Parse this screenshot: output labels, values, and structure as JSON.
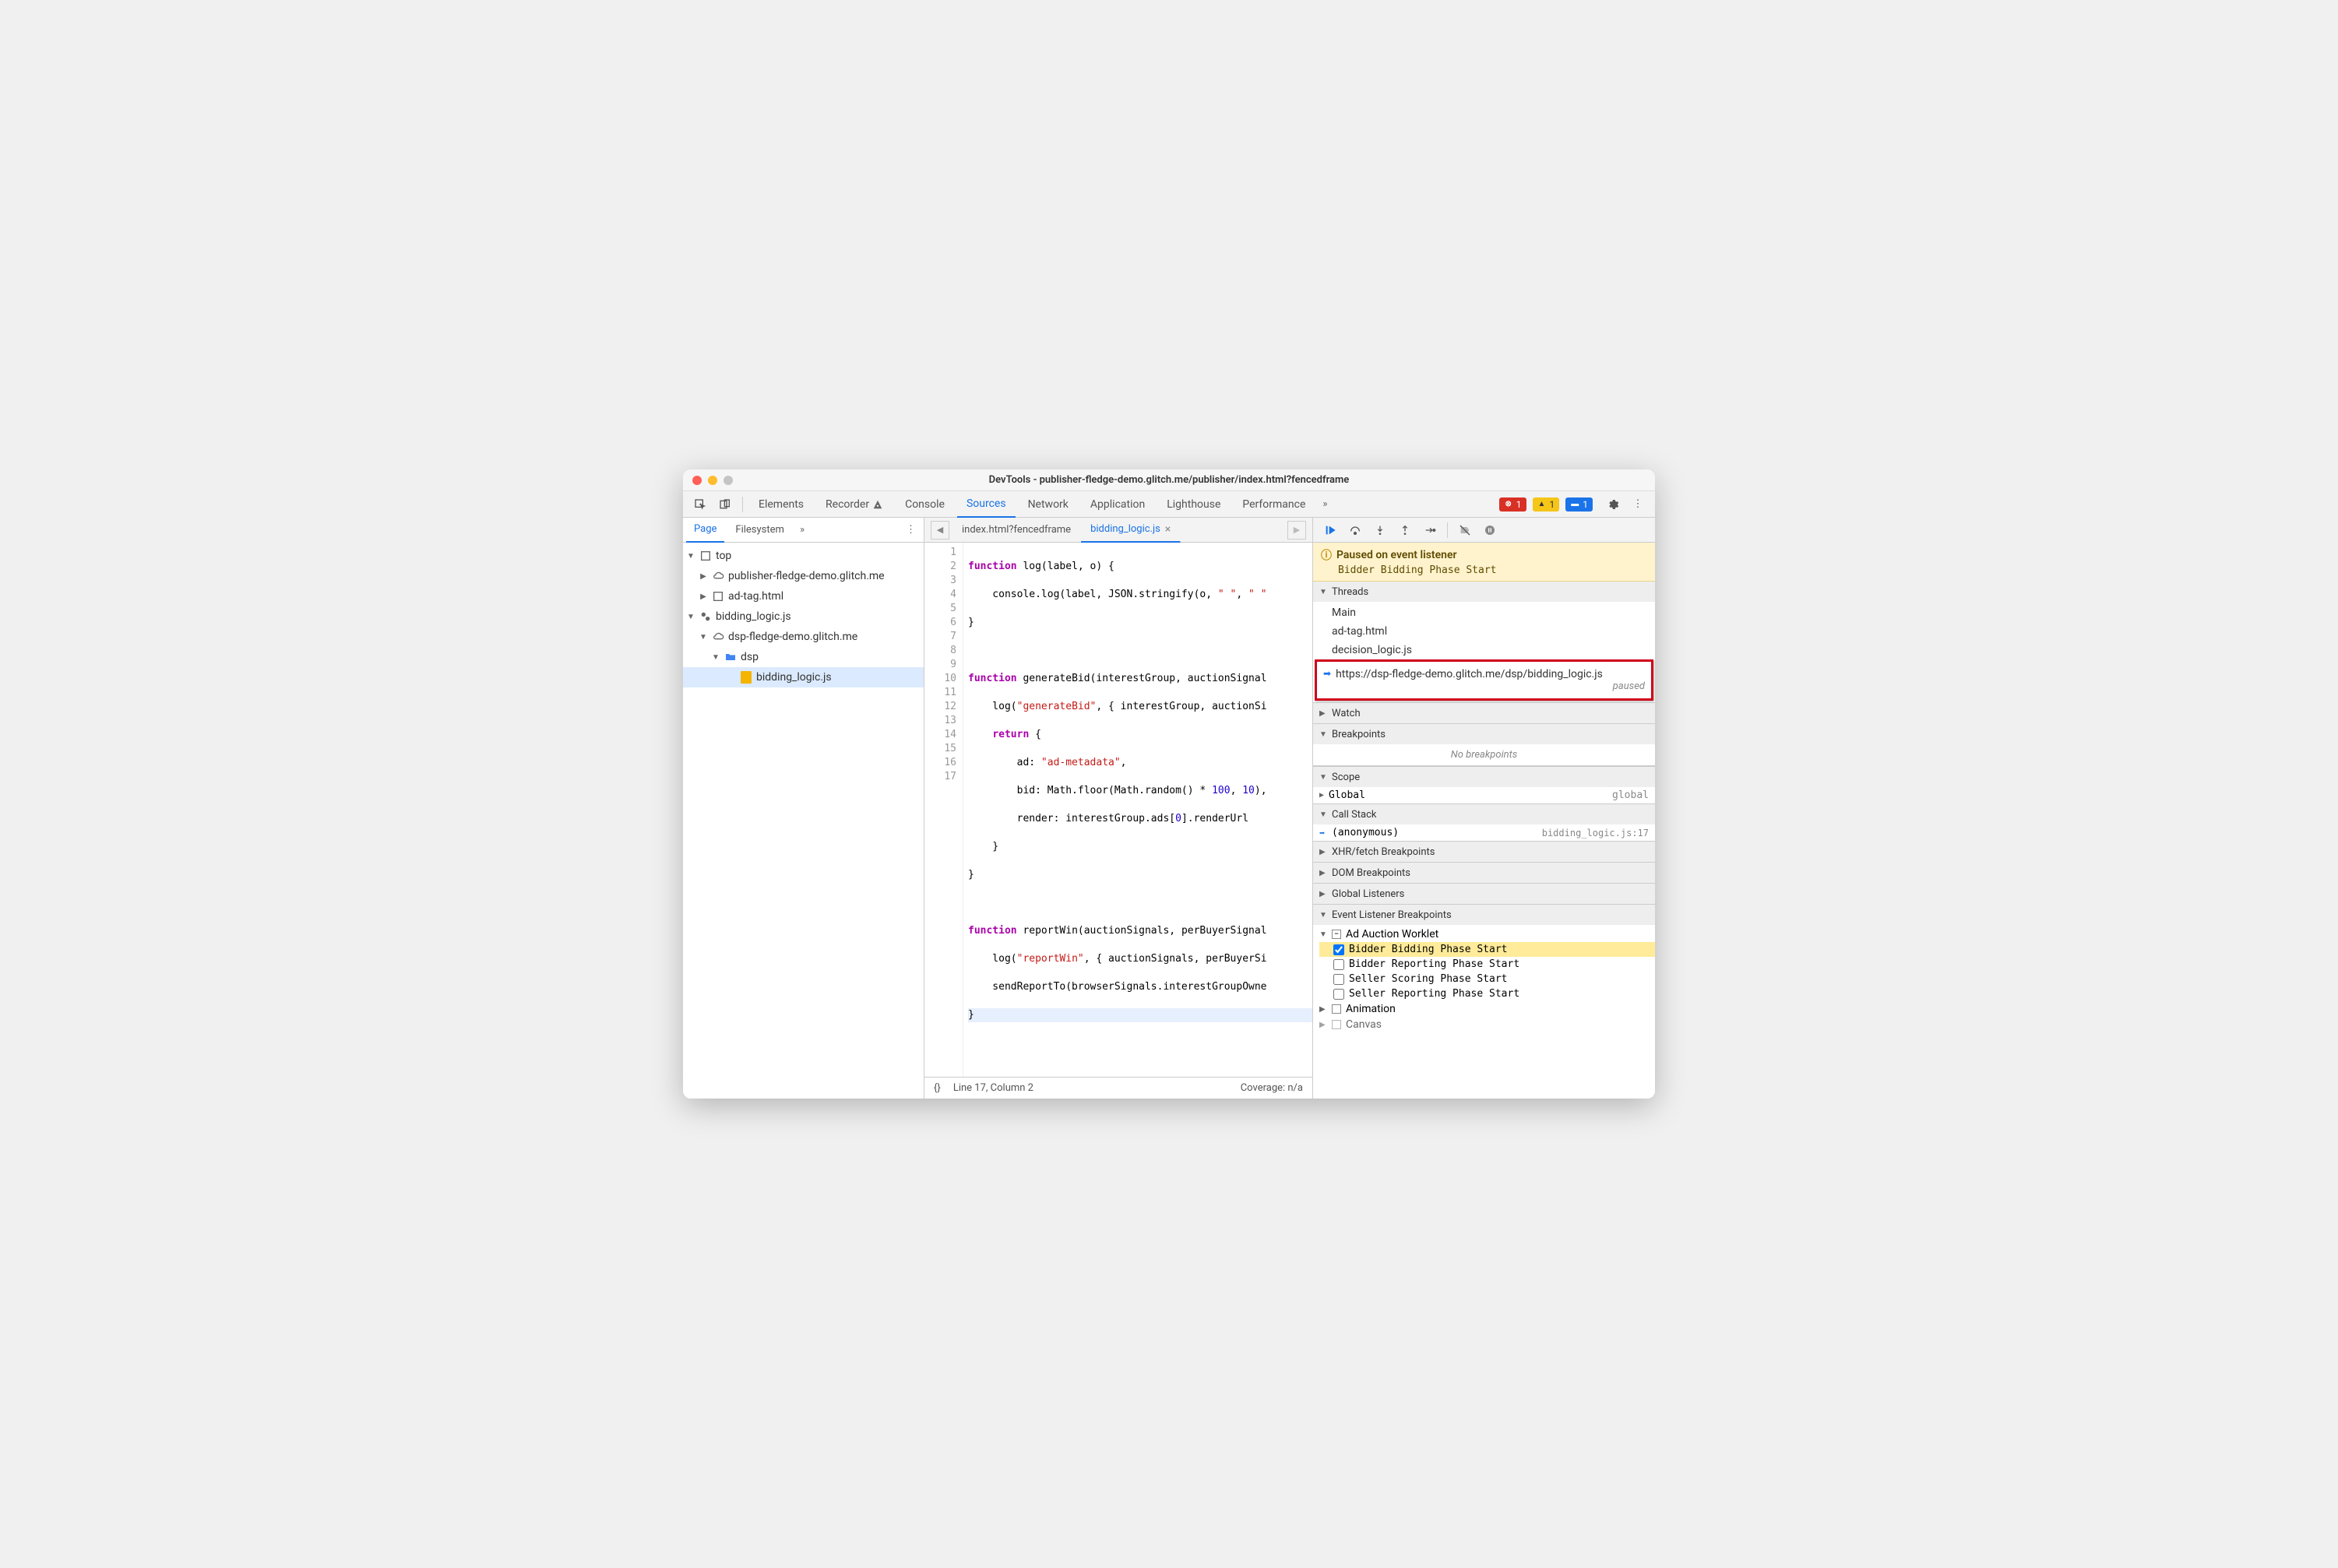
{
  "titlebar": "DevTools - publisher-fledge-demo.glitch.me/publisher/index.html?fencedframe",
  "mainTabs": {
    "elements": "Elements",
    "recorder": "Recorder",
    "console": "Console",
    "sources": "Sources",
    "network": "Network",
    "application": "Application",
    "lighthouse": "Lighthouse",
    "performance": "Performance"
  },
  "badges": {
    "errors": "1",
    "warnings": "1",
    "messages": "1"
  },
  "navTabs": {
    "page": "Page",
    "filesystem": "Filesystem"
  },
  "tree": {
    "top": "top",
    "pub": "publisher-fledge-demo.glitch.me",
    "adtag": "ad-tag.html",
    "bidding_root": "bidding_logic.js",
    "dsp_domain": "dsp-fledge-demo.glitch.me",
    "dsp_folder": "dsp",
    "bidding_file": "bidding_logic.js"
  },
  "editorTabs": {
    "idx": "index.html?fencedframe",
    "bid": "bidding_logic.js"
  },
  "code": {
    "l1": "function log(label, o) {",
    "l2": "    console.log(label, JSON.stringify(o, \" \", \" \"",
    "l3": "}",
    "l4": "",
    "l5": "function generateBid(interestGroup, auctionSignal",
    "l6": "    log(\"generateBid\", { interestGroup, auctionSi",
    "l7": "    return {",
    "l8": "        ad: \"ad-metadata\",",
    "l9": "        bid: Math.floor(Math.random() * 100, 10),",
    "l10": "        render: interestGroup.ads[0].renderUrl",
    "l11": "    }",
    "l12": "}",
    "l13": "",
    "l14": "function reportWin(auctionSignals, perBuyerSignal",
    "l15": "    log(\"reportWin\", { auctionSignals, perBuyerSi",
    "l16": "    sendReportTo(browserSignals.interestGroupOwne",
    "l17": "}"
  },
  "status": {
    "pretty": "{}",
    "pos": "Line 17, Column 2",
    "coverage": "Coverage: n/a"
  },
  "pause": {
    "title": "Paused on event listener",
    "subtitle": "Bidder Bidding Phase Start"
  },
  "threads": {
    "header": "Threads",
    "main": "Main",
    "adtag": "ad-tag.html",
    "decision": "decision_logic.js",
    "current": "https://dsp-fledge-demo.glitch.me/dsp/bidding_logic.js",
    "paused": "paused"
  },
  "sections": {
    "watch": "Watch",
    "breakpoints": "Breakpoints",
    "nobreak": "No breakpoints",
    "scope": "Scope",
    "global": "Global",
    "global_val": "global",
    "callstack": "Call Stack",
    "anon": "(anonymous)",
    "anon_loc": "bidding_logic.js:17",
    "xhr": "XHR/fetch Breakpoints",
    "dom": "DOM Breakpoints",
    "gl": "Global Listeners",
    "evt": "Event Listener Breakpoints"
  },
  "evt": {
    "adauction": "Ad Auction Worklet",
    "bbs": "Bidder Bidding Phase Start",
    "brs": "Bidder Reporting Phase Start",
    "sss": "Seller Scoring Phase Start",
    "srs": "Seller Reporting Phase Start",
    "animation": "Animation",
    "canvas": "Canvas"
  }
}
